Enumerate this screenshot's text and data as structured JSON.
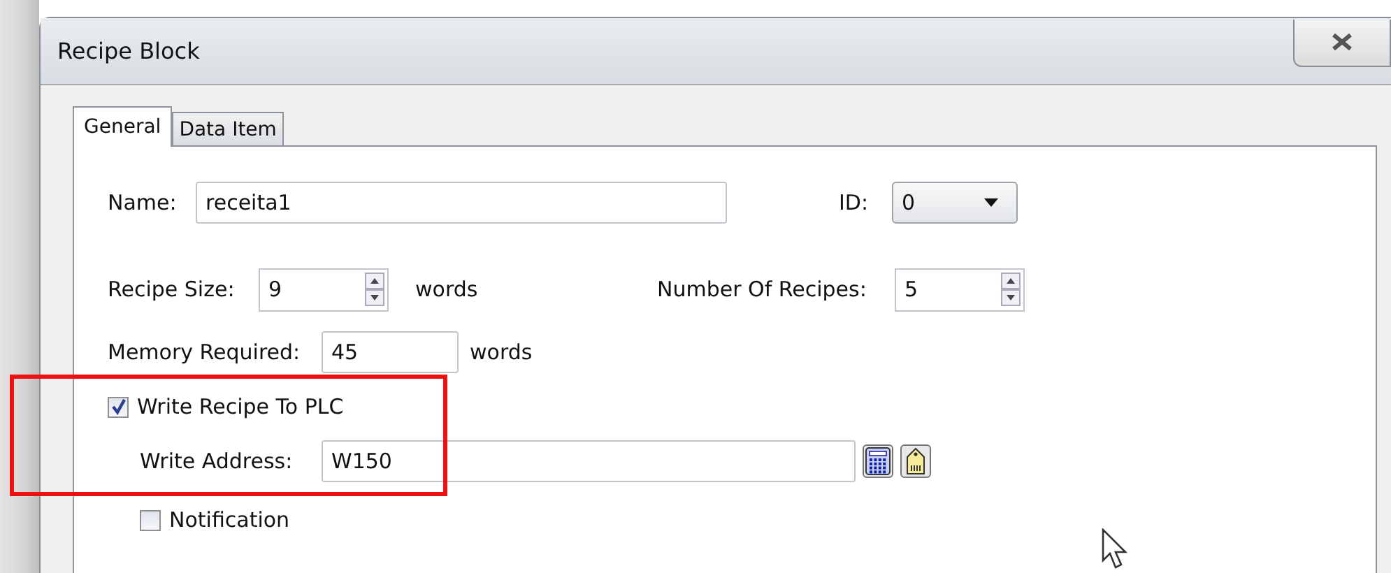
{
  "window": {
    "title": "Recipe Block"
  },
  "tabs": [
    {
      "label": "General",
      "selected": true
    },
    {
      "label": "Data Item",
      "selected": false
    }
  ],
  "name": {
    "label": "Name:",
    "value": "receita1"
  },
  "id": {
    "label": "ID:",
    "value": "0"
  },
  "recipe_size": {
    "label": "Recipe Size:",
    "value": "9",
    "unit": "words"
  },
  "number_of_recipes": {
    "label": "Number Of Recipes:",
    "value": "5"
  },
  "memory_required": {
    "label": "Memory Required:",
    "value": "45",
    "unit": "words"
  },
  "write_recipe": {
    "label": "Write Recipe To PLC",
    "checked": true
  },
  "write_address": {
    "label": "Write Address:",
    "value": "W150"
  },
  "notification": {
    "label": "Notification",
    "checked": false
  }
}
